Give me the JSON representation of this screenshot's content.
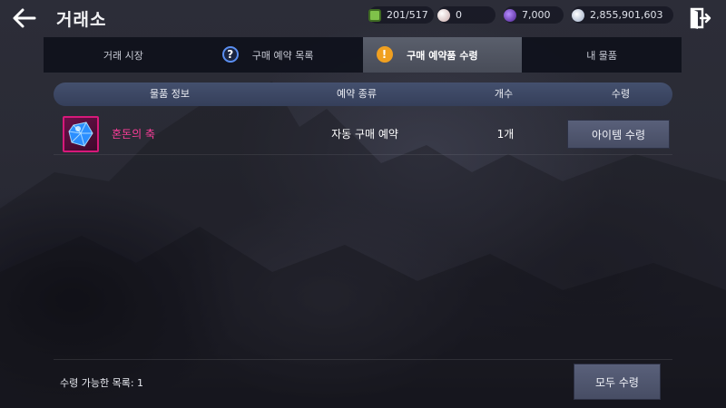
{
  "header": {
    "title": "거래소",
    "currencies": [
      {
        "icon": "energy-icon",
        "value": "201/517",
        "color": "#7fc24a"
      },
      {
        "icon": "pearl-icon",
        "value": "0",
        "color": "#e8d6d6"
      },
      {
        "icon": "purple-gem-icon",
        "value": "7,000",
        "color": "#7a3fd0"
      },
      {
        "icon": "silver-coin-icon",
        "value": "2,855,901,603",
        "color": "#c9d4e6"
      }
    ]
  },
  "tabs": [
    {
      "label": "거래 시장",
      "active": false
    },
    {
      "label": "구매 예약 목록",
      "active": false,
      "badge": "?"
    },
    {
      "label": "구매 예약품 수령",
      "active": true,
      "badge": "!"
    },
    {
      "label": "내 물품",
      "active": false
    }
  ],
  "table": {
    "columns": [
      "물품 정보",
      "예약 종류",
      "개수",
      "수령"
    ],
    "rows": [
      {
        "name": "혼돈의 축",
        "type": "자동 구매 예약",
        "count": "1개",
        "button": "아이템 수령"
      }
    ]
  },
  "footer": {
    "claimable_label": "수령 가능한 목록: 1",
    "claim_all_label": "모두 수령"
  },
  "colors": {
    "accent_pink": "#ff3d9a",
    "alert_orange": "#f0a020",
    "help_blue": "#5a8ef0"
  }
}
